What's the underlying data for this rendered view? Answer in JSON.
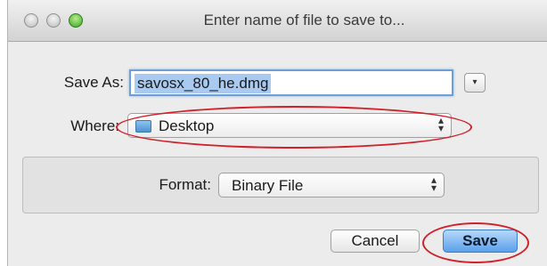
{
  "window": {
    "title": "Enter name of file to save to...",
    "controls": [
      "close-icon",
      "minimize-icon",
      "zoom-icon"
    ]
  },
  "save_as": {
    "label": "Save As:",
    "value": "savosx_80_he.dmg"
  },
  "expand_button": {
    "icon": "disclosure-triangle-icon",
    "glyph": "▾"
  },
  "where": {
    "label": "Where:",
    "value": "Desktop",
    "icon": "folder-icon"
  },
  "format": {
    "label": "Format:",
    "value": "Binary File"
  },
  "buttons": {
    "cancel": "Cancel",
    "save": "Save"
  },
  "colors": {
    "annotation": "#d0202a",
    "accent": "#5aa0ea"
  }
}
